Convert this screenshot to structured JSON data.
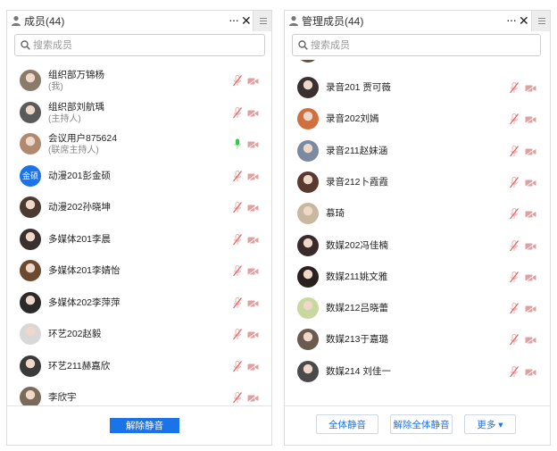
{
  "left": {
    "title": "成员(44)",
    "more": "···",
    "close": "✕",
    "search_placeholder": "搜索成员",
    "members": [
      {
        "name": "组织部万锦杨",
        "sub": "(我)",
        "avatar": "photo",
        "avatar_color": "#8a7a6a",
        "mic": "muted",
        "cam": "off"
      },
      {
        "name": "组织部刘航瑀",
        "sub": "(主持人)",
        "avatar": "photo",
        "avatar_color": "#5a5a5a",
        "mic": "muted",
        "cam": "off"
      },
      {
        "name": "会议用户875624",
        "sub": "(联席主持人)",
        "avatar": "photo",
        "avatar_color": "#b08a70",
        "mic": "active",
        "cam": "off"
      },
      {
        "name": "动漫201彭金硕",
        "sub": "",
        "avatar": "text",
        "avatar_text": "金硕",
        "avatar_color": "#1a73e8",
        "mic": "muted",
        "cam": "off"
      },
      {
        "name": "动漫202孙晓坤",
        "sub": "",
        "avatar": "photo",
        "avatar_color": "#4a3a30",
        "mic": "muted",
        "cam": "off"
      },
      {
        "name": "多媒体201李晨",
        "sub": "",
        "avatar": "photo",
        "avatar_color": "#3a3030",
        "mic": "muted",
        "cam": "off"
      },
      {
        "name": "多媒体201李婧怡",
        "sub": "",
        "avatar": "photo",
        "avatar_color": "#6a4a30",
        "mic": "muted",
        "cam": "off"
      },
      {
        "name": "多媒体202李萍萍",
        "sub": "",
        "avatar": "photo",
        "avatar_color": "#2a2a2a",
        "mic": "muted",
        "cam": "off"
      },
      {
        "name": "环艺202赵毅",
        "sub": "",
        "avatar": "photo",
        "avatar_color": "#d8d8d8",
        "mic": "muted",
        "cam": "off"
      },
      {
        "name": "环艺211赫嘉欣",
        "sub": "",
        "avatar": "photo",
        "avatar_color": "#3a3a3a",
        "mic": "muted",
        "cam": "off"
      },
      {
        "name": "李欣宇",
        "sub": "",
        "avatar": "photo",
        "avatar_color": "#7a6a5a",
        "mic": "muted",
        "cam": "off"
      }
    ],
    "unmute_button": "解除静音"
  },
  "right": {
    "title": "管理成员(44)",
    "more": "···",
    "close": "✕",
    "search_placeholder": "搜索成员",
    "members": [
      {
        "name": "录音201 贾可薇",
        "avatar_color": "#3a3030",
        "mic": "muted",
        "cam": "off"
      },
      {
        "name": "录音202刘嫣",
        "avatar_color": "#d07040",
        "mic": "muted",
        "cam": "off"
      },
      {
        "name": "录音211赵妹涵",
        "avatar_color": "#7a8aa0",
        "mic": "muted",
        "cam": "off"
      },
      {
        "name": "录音212卜霞霞",
        "avatar_color": "#5a3a30",
        "mic": "muted",
        "cam": "off"
      },
      {
        "name": "慕琦",
        "avatar_color": "#c8b8a0",
        "mic": "muted",
        "cam": "off"
      },
      {
        "name": "数媒202冯佳楠",
        "avatar_color": "#3a2a2a",
        "mic": "muted",
        "cam": "off"
      },
      {
        "name": "数媒211姚文雅",
        "avatar_color": "#2a2020",
        "mic": "muted",
        "cam": "off"
      },
      {
        "name": "数媒212吕晓蕾",
        "avatar_color": "#c8d8a0",
        "mic": "muted",
        "cam": "off"
      },
      {
        "name": "数媒213于嘉璐",
        "avatar_color": "#6a5a50",
        "mic": "muted",
        "cam": "off"
      },
      {
        "name": "数媒214 刘佳一",
        "avatar_color": "#4a4a4a",
        "mic": "muted",
        "cam": "off"
      }
    ],
    "mute_all": "全体静音",
    "unmute_all": "解除全体静音",
    "more_button": "更多 ▾"
  },
  "colors": {
    "accent": "#1a73e8",
    "muted_red": "#e06060",
    "active_green": "#2ecc40",
    "cam_off": "#e0a0a0"
  }
}
